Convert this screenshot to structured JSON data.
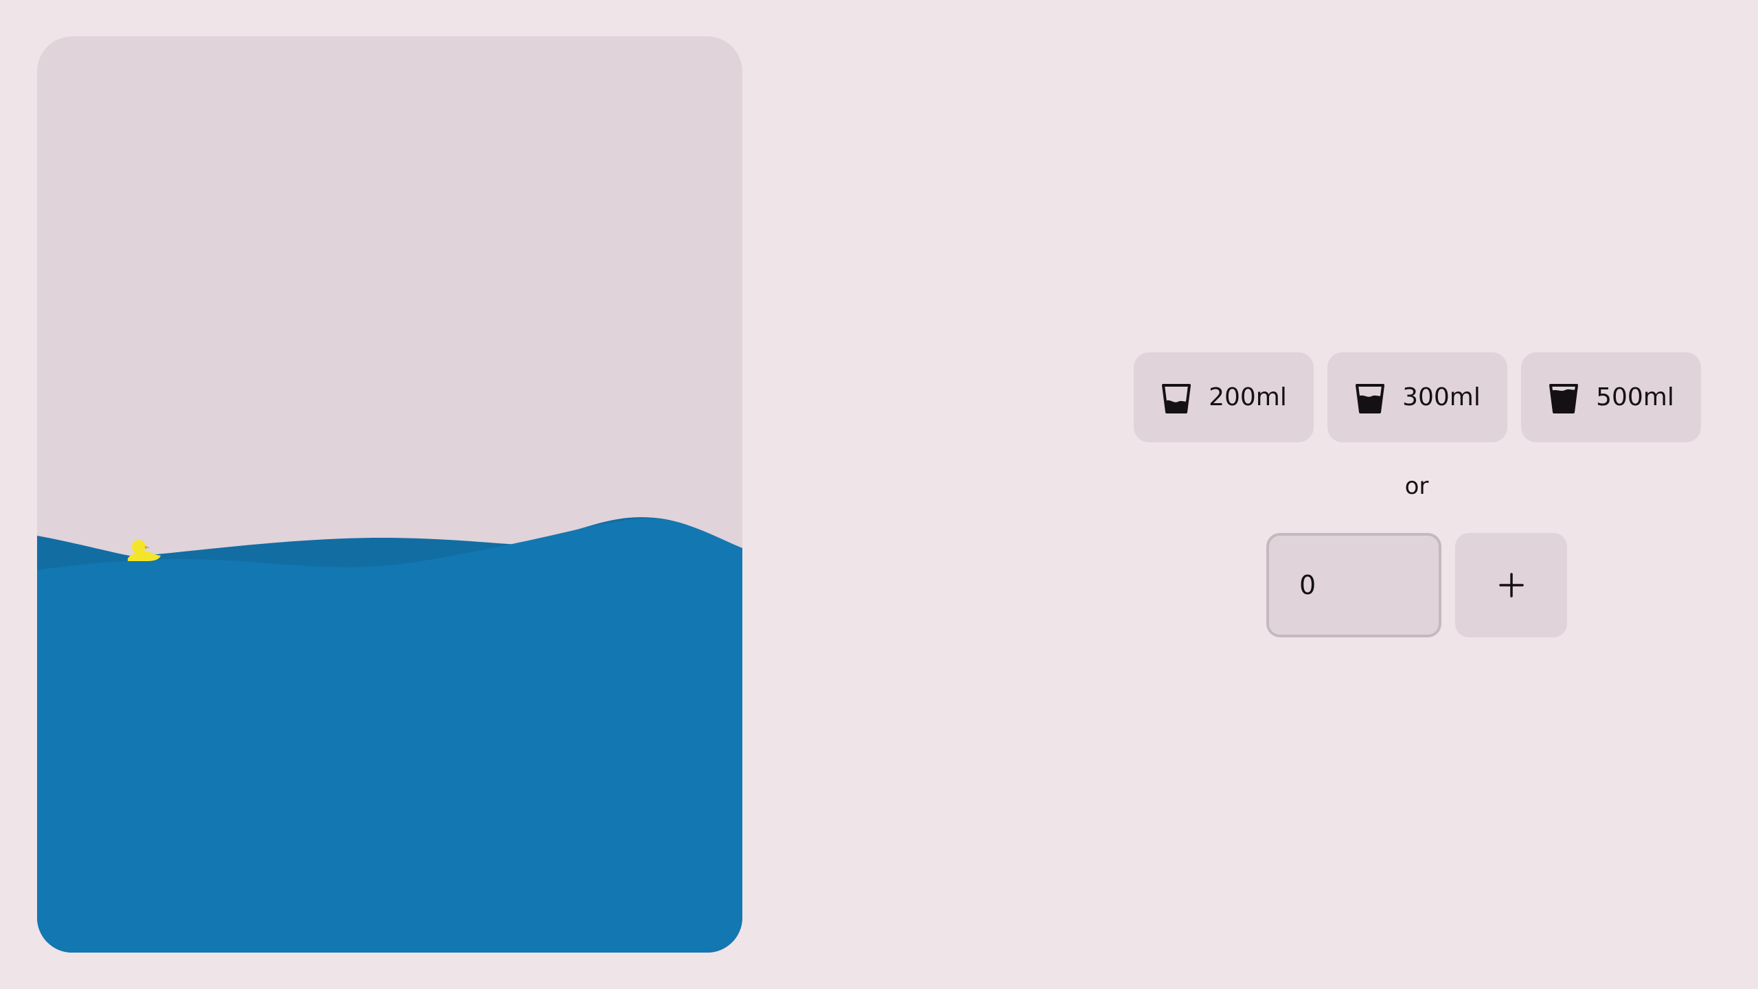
{
  "water_level_fraction": 0.42,
  "colors": {
    "page_background": "#efe4e8",
    "surface": "#e0d3da",
    "water": "#1377b1",
    "water_back_wave": "#126da3",
    "duck": "#f4e52a",
    "text": "#141014"
  },
  "quick_add": {
    "buttons": [
      {
        "label": "200ml",
        "icon": "glass-low-fill-icon"
      },
      {
        "label": "300ml",
        "icon": "glass-half-fill-icon"
      },
      {
        "label": "500ml",
        "icon": "glass-full-fill-icon"
      }
    ]
  },
  "separator_text": "or",
  "custom_amount": {
    "value": "0"
  },
  "add_button": {
    "icon": "plus-icon"
  }
}
